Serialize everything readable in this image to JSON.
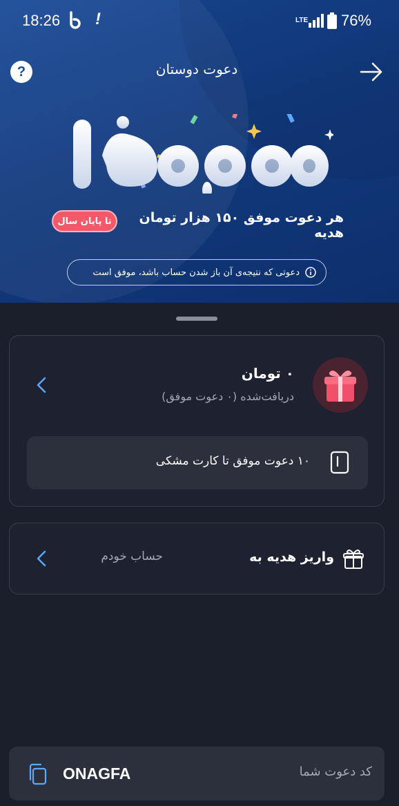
{
  "status_bar": {
    "time": "18:26",
    "network": "LTE",
    "battery": "76%"
  },
  "header": {
    "title": "دعوت دوستان",
    "help_icon": "question-circle-icon",
    "back_icon": "arrow-right-icon"
  },
  "hero": {
    "big_number": "۱۵۰,۰۰۰",
    "promo_text": "هر دعوت موفق ۱۵۰ هزار تومان هدیه",
    "badge": "تا پایان سال",
    "note": "دعوتی که نتیجه‌ی آن باز شدن حساب باشد، موفق است",
    "note_icon": "info-icon",
    "colors": {
      "hero_bg": "#123a7e",
      "badge": "#f25a6a"
    }
  },
  "rewards": {
    "amount": "۰ تومان",
    "received": "دریافت‌شده (۰ دعوت موفق)",
    "gift_icon": "gift-icon",
    "chevron_icon": "chevron-left-icon",
    "milestone": "۱۰ دعوت موفق تا کارت مشکی",
    "milestone_icon": "card-icon"
  },
  "deposit": {
    "label": "واریز هدیه به",
    "account": "حساب خودم",
    "icon": "gift-outline-icon",
    "chevron_icon": "chevron-left-icon"
  },
  "invite_code": {
    "label": "کد دعوت شما",
    "value": "ONAGFA",
    "copy_icon": "copy-icon"
  }
}
